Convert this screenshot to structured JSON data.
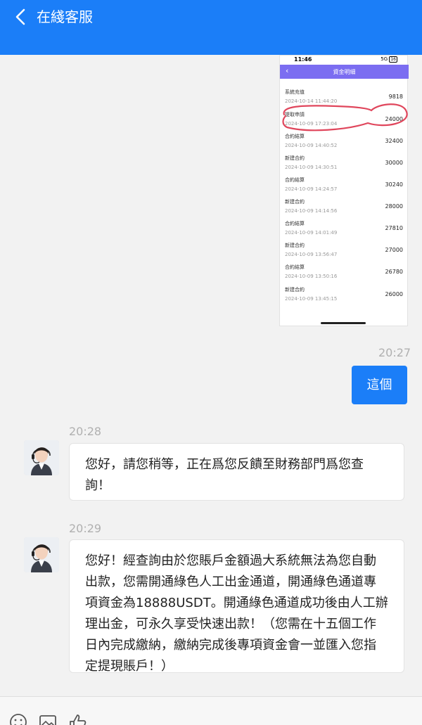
{
  "header": {
    "title": "在綫客服",
    "bg_color": "#1b7ef8",
    "back_icon": "chevron-left-icon"
  },
  "shared_image": {
    "status_time": "11:46",
    "status_signal": "5G",
    "battery": "16",
    "title": "資金明細",
    "accent_color": "#7b6df1",
    "rows": [
      {
        "name": "系統充值",
        "date": "2024-10-14 11:44:20",
        "amount": "9818"
      },
      {
        "name": "提取申請",
        "date": "2024-10-09 17:23:04",
        "amount": "24000"
      },
      {
        "name": "合約結算",
        "date": "2024-10-09 14:40:52",
        "amount": "32400"
      },
      {
        "name": "新建合約",
        "date": "2024-10-09 14:30:51",
        "amount": "30000"
      },
      {
        "name": "合約結算",
        "date": "2024-10-09 14:24:57",
        "amount": "30240"
      },
      {
        "name": "新建合約",
        "date": "2024-10-09 14:14:56",
        "amount": "28000"
      },
      {
        "name": "合約結算",
        "date": "2024-10-09 14:01:49",
        "amount": "27810"
      },
      {
        "name": "新建合約",
        "date": "2024-10-09 13:56:47",
        "amount": "27000"
      },
      {
        "name": "合約結算",
        "date": "2024-10-09 13:50:16",
        "amount": "26780"
      },
      {
        "name": "新建合約",
        "date": "2024-10-09 13:45:15",
        "amount": "26000"
      }
    ]
  },
  "messages": {
    "out_time": "20:27",
    "out_text": "這個",
    "in1_time": "20:28",
    "in1_lines": [
      "您好，請您稍等，正在爲您反饋至財務部門爲您查",
      "詢！"
    ],
    "in2_time": "20:29",
    "in2_lines": [
      "您好！經查詢由於您賬戶金額過大系統無法為您自動",
      "出款，您需開通綠色人工出金通道，開通綠色通道專",
      "項資金為18888USDT。開通綠色通道成功後由人工辦",
      "理出金，可永久享受快速出款！（您需在十五個工作",
      "日內完成繳納，繳納完成後專項資金會一並匯入您指",
      "定提現賬戶！）"
    ]
  },
  "toolbar": {
    "icons": [
      "emoji-icon",
      "image-icon",
      "thumbs-up-icon"
    ]
  }
}
